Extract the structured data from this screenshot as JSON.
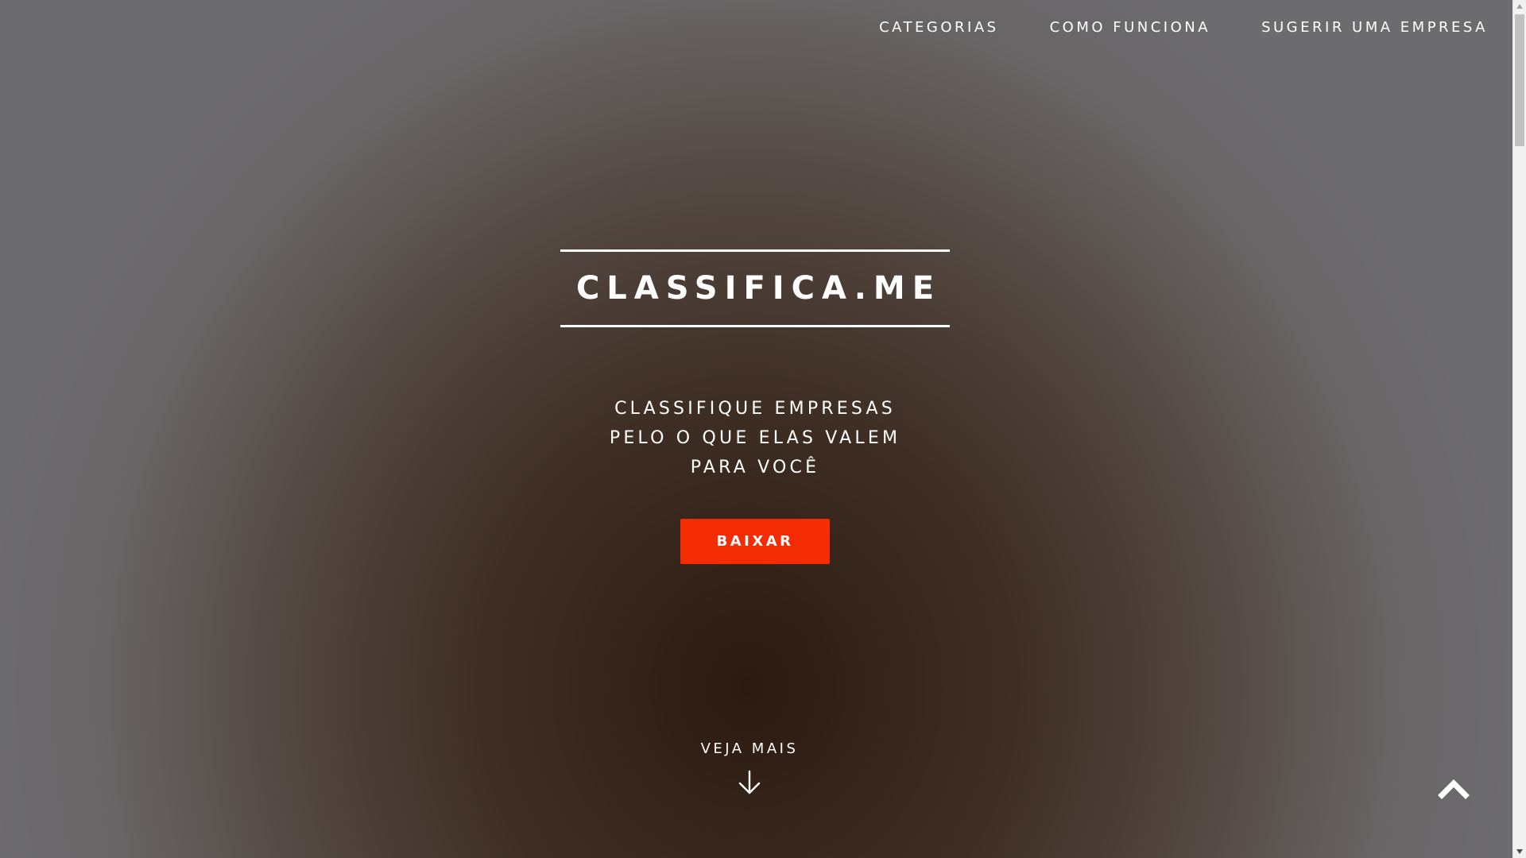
{
  "nav": {
    "items": [
      {
        "label": "CATEGORIAS"
      },
      {
        "label": "COMO FUNCIONA"
      },
      {
        "label": "SUGERIR UMA EMPRESA"
      }
    ]
  },
  "hero": {
    "logo": "CLASSIFICA.ME",
    "tagline": [
      "CLASSIFIQUE EMPRESAS",
      "PELO O QUE ELAS VALEM",
      "PARA VOCÊ"
    ],
    "cta_label": "BAIXAR"
  },
  "more": {
    "label": "VEJA MAIS",
    "icon": "arrow-down-icon"
  },
  "back_to_top": {
    "icon": "chevron-up-icon"
  },
  "colors": {
    "accent": "#f42c04",
    "text": "#ffffff"
  }
}
